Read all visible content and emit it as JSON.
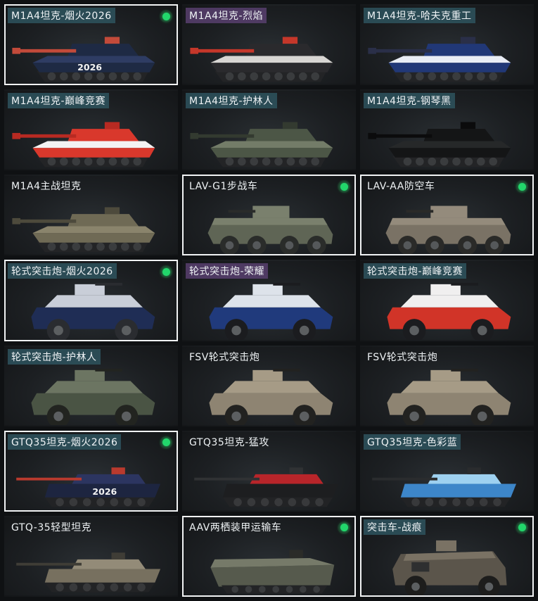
{
  "items": [
    {
      "label": "M1A4坦克-烟火2026",
      "kind": "tank",
      "badge": "2026",
      "selected": true,
      "check": true,
      "hl": "teal",
      "colors": [
        "#1e2a44",
        "#2e3c63",
        "#c24a3a"
      ]
    },
    {
      "label": "M1A4坦克-烈焰",
      "kind": "tank",
      "badge": "",
      "selected": false,
      "check": false,
      "hl": "purple",
      "colors": [
        "#2a2a2d",
        "#d8d6d3",
        "#c5372a"
      ]
    },
    {
      "label": "M1A4坦克-哈夫克重工",
      "kind": "tank",
      "badge": "",
      "selected": false,
      "check": false,
      "hl": "teal",
      "colors": [
        "#213877",
        "#e9edf5",
        "#2a2f48"
      ]
    },
    {
      "label": "M1A4坦克-巅峰竞赛",
      "kind": "tank",
      "badge": "",
      "selected": false,
      "check": false,
      "hl": "teal",
      "colors": [
        "#d9382c",
        "#f3f3f3",
        "#b82a22"
      ]
    },
    {
      "label": "M1A4坦克-护林人",
      "kind": "tank",
      "badge": "",
      "selected": false,
      "check": false,
      "hl": "teal",
      "colors": [
        "#4c5646",
        "#737c68",
        "#333a30"
      ]
    },
    {
      "label": "M1A4坦克-钢琴黑",
      "kind": "tank",
      "badge": "",
      "selected": false,
      "check": false,
      "hl": "teal",
      "colors": [
        "#141516",
        "#262829",
        "#0b0b0c"
      ]
    },
    {
      "label": "M1A4主战坦克",
      "kind": "tank",
      "badge": "",
      "selected": false,
      "check": false,
      "hl": "",
      "colors": [
        "#6f6a55",
        "#8a846c",
        "#4d4a3c"
      ]
    },
    {
      "label": "LAV-G1步战车",
      "kind": "lav",
      "badge": "",
      "selected": true,
      "check": true,
      "hl": "",
      "colors": [
        "#5f6555",
        "#7a806d",
        "#2a2c2a"
      ]
    },
    {
      "label": "LAV-AA防空车",
      "kind": "lav",
      "badge": "",
      "selected": true,
      "check": true,
      "hl": "",
      "colors": [
        "#7a7265",
        "#948b7c",
        "#2a2a28"
      ]
    },
    {
      "label": "轮式突击炮-烟火2026",
      "kind": "wheel",
      "badge": "",
      "selected": true,
      "check": true,
      "hl": "teal",
      "colors": [
        "#1f2d55",
        "#c9ced8",
        "#2a2c30"
      ]
    },
    {
      "label": "轮式突击炮-荣耀",
      "kind": "wheel",
      "badge": "",
      "selected": false,
      "check": false,
      "hl": "purple",
      "colors": [
        "#203a7c",
        "#dde3ea",
        "#1b1c1f"
      ]
    },
    {
      "label": "轮式突击炮-巅峰竞赛",
      "kind": "wheel",
      "badge": "",
      "selected": false,
      "check": false,
      "hl": "teal",
      "colors": [
        "#d13428",
        "#f0efef",
        "#1b1c1f"
      ]
    },
    {
      "label": "轮式突击炮-护林人",
      "kind": "wheel",
      "badge": "",
      "selected": false,
      "check": false,
      "hl": "teal",
      "colors": [
        "#4a5444",
        "#6c7562",
        "#222420"
      ]
    },
    {
      "label": "FSV轮式突击炮",
      "kind": "wheel",
      "badge": "",
      "selected": false,
      "check": false,
      "hl": "",
      "colors": [
        "#8e8472",
        "#a69b86",
        "#222220"
      ]
    },
    {
      "label": "FSV轮式突击炮",
      "kind": "wheel",
      "badge": "",
      "selected": false,
      "check": false,
      "hl": "",
      "colors": [
        "#8e8472",
        "#a69b86",
        "#222220"
      ]
    },
    {
      "label": "GTQ35坦克-烟火2026",
      "kind": "ltank",
      "badge": "2026",
      "selected": true,
      "check": true,
      "hl": "teal",
      "colors": [
        "#1d2540",
        "#2c3560",
        "#b93a2e"
      ]
    },
    {
      "label": "GTQ35坦克-猛攻",
      "kind": "ltank",
      "badge": "",
      "selected": false,
      "check": false,
      "hl": "",
      "colors": [
        "#1d1e20",
        "#b8252a",
        "#303234"
      ]
    },
    {
      "label": "GTQ35坦克-色彩蓝",
      "kind": "ltank",
      "badge": "",
      "selected": false,
      "check": false,
      "hl": "teal",
      "colors": [
        "#3d86c9",
        "#9ed1f0",
        "#2a2c2e"
      ]
    },
    {
      "label": "GTQ-35轻型坦克",
      "kind": "ltank",
      "badge": "",
      "selected": false,
      "check": false,
      "hl": "",
      "colors": [
        "#77705f",
        "#938b78",
        "#3f3d36"
      ]
    },
    {
      "label": "AAV两栖装甲运输车",
      "kind": "aav",
      "badge": "",
      "selected": true,
      "check": true,
      "hl": "",
      "colors": [
        "#565a4d",
        "#767a69",
        "#2b2c28"
      ]
    },
    {
      "label": "突击车-战痕",
      "kind": "mrap",
      "badge": "",
      "selected": true,
      "check": true,
      "hl": "teal",
      "colors": [
        "#5b554b",
        "#7a7264",
        "#1d1d1c"
      ]
    }
  ]
}
